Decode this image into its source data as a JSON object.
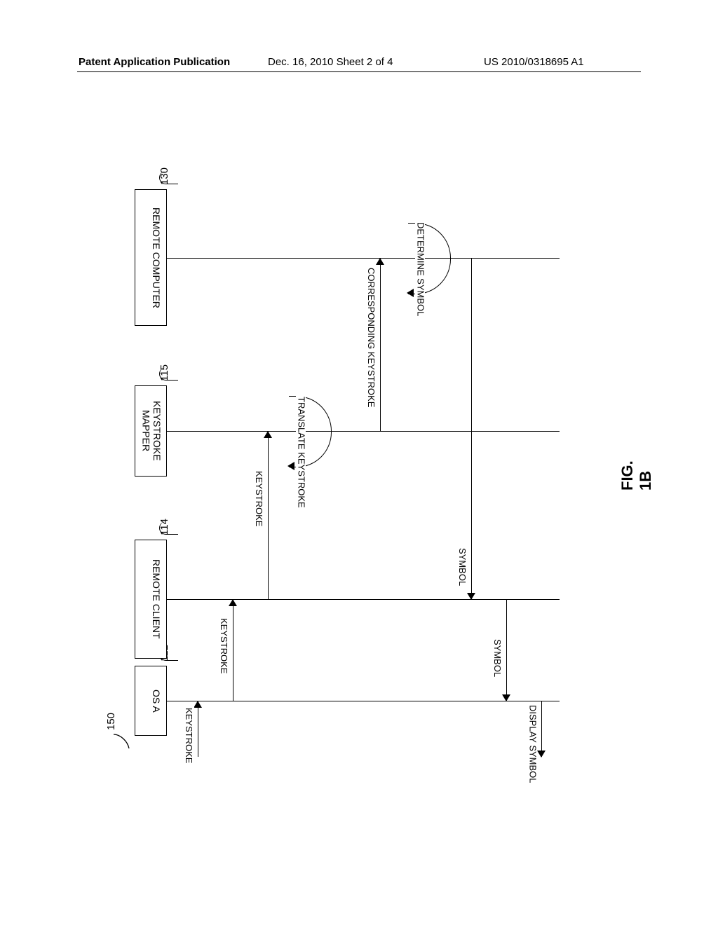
{
  "header": {
    "left": "Patent Application Publication",
    "middle": "Dec. 16, 2010  Sheet 2 of 4",
    "right": "US 2010/0318695 A1"
  },
  "refs": {
    "diagram": "150",
    "osA": "112",
    "remoteClient": "114",
    "keystrokeMapper": "115",
    "remoteComputer": "130"
  },
  "actors": {
    "osA": "OS A",
    "remoteClient": "REMOTE CLIENT",
    "keystrokeMapper": "KEYSTROKE MAPPER",
    "remoteComputer": "REMOTE COMPUTER"
  },
  "messages": {
    "keystrokeIn": "KEYSTROKE",
    "k1": "KEYSTROKE",
    "k2": "KEYSTROKE",
    "translate": "TRANSLATE KEYSTROKE",
    "corresponding": "CORRESPONDING KEYSTROKE",
    "determine": "DETERMINE SYMBOL",
    "symbol1": "SYMBOL",
    "symbol2": "SYMBOL",
    "display": "DISPLAY SYMBOL"
  },
  "figure": "FIG. 1B"
}
